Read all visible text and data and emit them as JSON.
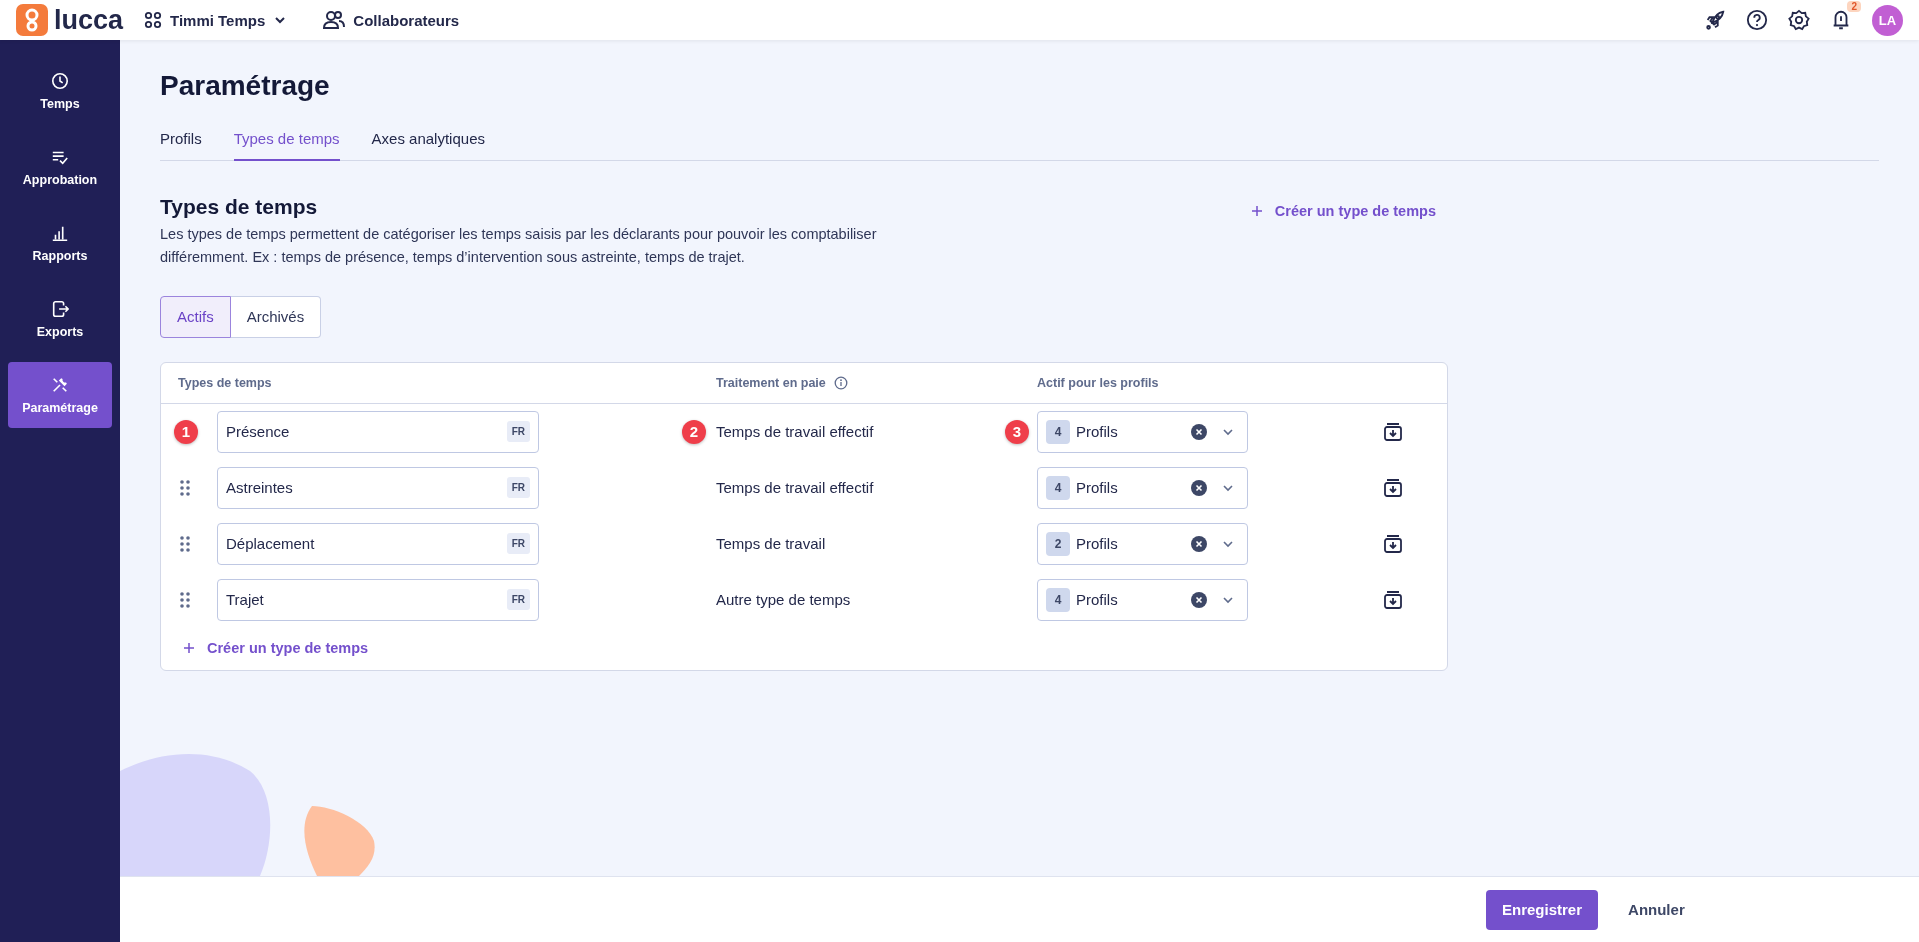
{
  "topbar": {
    "logo": "lucca",
    "app_menu": "Timmi Temps",
    "nav_link": "Collaborateurs",
    "notification_count": "2",
    "avatar": "LA"
  },
  "sidebar": {
    "items": [
      {
        "label": "Temps",
        "selected": false
      },
      {
        "label": "Approbation",
        "selected": false
      },
      {
        "label": "Rapports",
        "selected": false
      },
      {
        "label": "Exports",
        "selected": false
      },
      {
        "label": "Paramétrage",
        "selected": true
      }
    ]
  },
  "page": {
    "title": "Paramétrage",
    "tabs": [
      {
        "label": "Profils",
        "selected": false
      },
      {
        "label": "Types de temps",
        "selected": true
      },
      {
        "label": "Axes analytiques",
        "selected": false
      }
    ]
  },
  "section": {
    "title": "Types de temps",
    "description": "Les types de temps permettent de catégoriser les temps saisis par les déclarants pour pouvoir les comptabiliser différemment. Ex : temps de présence, temps d’intervention sous astreinte, temps de trajet.",
    "create_link": "Créer un type de temps",
    "filters": [
      {
        "label": "Actifs",
        "selected": true
      },
      {
        "label": "Archivés",
        "selected": false
      }
    ]
  },
  "table": {
    "columns": [
      "Types de temps",
      "Traitement en paie",
      "Actif pour les profils"
    ],
    "rows": [
      {
        "name": "Présence",
        "lang": "FR",
        "treatment": "Temps de travail effectif",
        "profiles_count": "4",
        "profiles": "Profils",
        "name_marker": "1",
        "treatment_marker": "2",
        "profiles_marker": "3"
      },
      {
        "name": "Astreintes",
        "lang": "FR",
        "treatment": "Temps de travail effectif",
        "profiles_count": "4",
        "profiles": "Profils"
      },
      {
        "name": "Déplacement",
        "lang": "FR",
        "treatment": "Temps de travail",
        "profiles_count": "2",
        "profiles": "Profils"
      },
      {
        "name": "Trajet",
        "lang": "FR",
        "treatment": "Autre type de temps",
        "profiles_count": "4",
        "profiles": "Profils"
      }
    ],
    "create_link": "Créer un type de temps"
  },
  "footer": {
    "buttons": [
      {
        "label": "Enregistrer",
        "kind": "primary"
      },
      {
        "label": "Annuler",
        "kind": "secondary"
      }
    ]
  }
}
